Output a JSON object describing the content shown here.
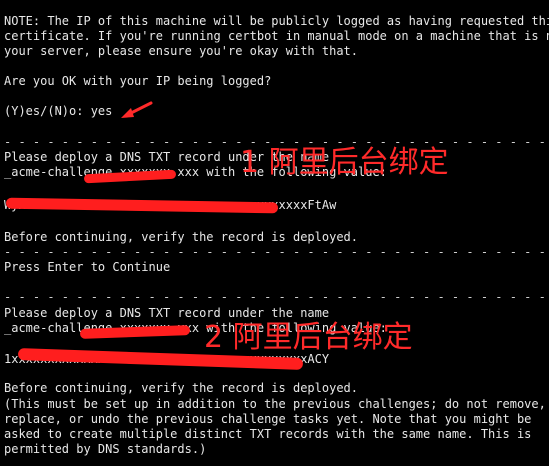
{
  "terminal": {
    "lines": {
      "note1": "NOTE: The IP of this machine will be publicly logged as having requested this",
      "note2": "certificate. If you're running certbot in manual mode on a machine that is not",
      "note3": "your server, please ensure you're okay with that.",
      "question": "Are you OK with your IP being logged?",
      "answer": "(Y)es/(N)o: yes",
      "sep1": "- - - - - - - - - - - - - - - - - - - - - - - - - - - - - - - - - - - - - - - -",
      "deploy1": "Please deploy a DNS TXT record under the name",
      "acme1": "_acme-challenge.xxxxxxx.xxx with the following value:",
      "value1": "WyxxxxxxxxxxxxxxxxxxxxxxxxxxxxxxxxxxxxxxxxFtAw",
      "verify1": "Before continuing, verify the record is deployed.",
      "sep2": "- - - - - - - - - - - - - - - - - - - - - - - - - - - - - - - - - - - - - - - -",
      "press": "Press Enter to Continue",
      "sep3": "- - - - - - - - - - - - - - - - - - - - - - - - - - - - - - - - - - - - - - - -",
      "deploy2": "Please deploy a DNS TXT record under the name",
      "acme2": "_acme-challenge.xxxxxxx.xxx with the following value:",
      "value2": "1xxxxxxxxxxxxxxxxxxPS3xxxxxxxxxxxxxxxxxxxxACY",
      "verify2": "Before continuing, verify the record is deployed.",
      "info1": "(This must be set up in addition to the previous challenges; do not remove,",
      "info2": "replace, or undo the previous challenge tasks yet. Note that you might be",
      "info3": "asked to create multiple distinct TXT records with the same name. This is",
      "info4": "permitted by DNS standards.)"
    }
  },
  "annotations": {
    "first": "1 阿里后台绑定",
    "second": "2 阿里后台绑定",
    "color": "#ff2a2a"
  }
}
